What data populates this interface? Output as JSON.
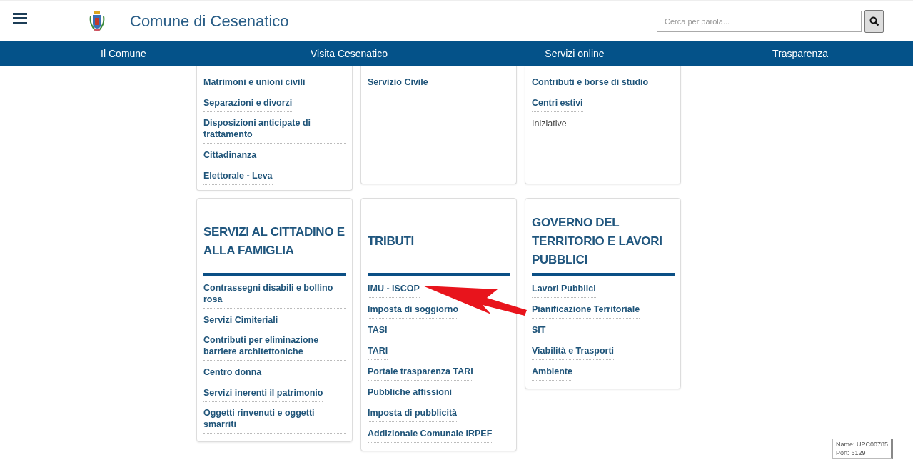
{
  "header": {
    "title": "Comune di Cesenatico",
    "search": {
      "placeholder": "Cerca per parola..."
    }
  },
  "nav": [
    {
      "label": "Il Comune"
    },
    {
      "label": "Visita Cesenatico"
    },
    {
      "label": "Servizi online"
    },
    {
      "label": "Trasparenza"
    }
  ],
  "card_rows": [
    [
      {
        "items": [
          {
            "label": "Matrimoni e unioni civili",
            "kind": "link"
          },
          {
            "label": "Separazioni e divorzi",
            "kind": "link"
          },
          {
            "label": "Disposizioni anticipate di trattamento",
            "kind": "link"
          },
          {
            "label": "Cittadinanza",
            "kind": "link"
          },
          {
            "label": "Elettorale - Leva",
            "kind": "link"
          }
        ]
      },
      {
        "items": [
          {
            "label": "Servizio Civile",
            "kind": "link"
          }
        ]
      },
      {
        "items": [
          {
            "label": "Contributi e borse di studio",
            "kind": "link"
          },
          {
            "label": "Centri estivi",
            "kind": "link"
          },
          {
            "label": "Iniziative",
            "kind": "plain"
          }
        ]
      }
    ],
    [
      {
        "heading": "SERVIZI AL CITTADINO E ALLA FAMIGLIA",
        "items": [
          {
            "label": "Contrassegni disabili e bollino rosa",
            "kind": "link"
          },
          {
            "label": "Servizi Cimiteriali",
            "kind": "link"
          },
          {
            "label": "Contributi per eliminazione barriere architettoniche",
            "kind": "link"
          },
          {
            "label": "Centro donna",
            "kind": "link"
          },
          {
            "label": "Servizi inerenti il patrimonio",
            "kind": "link"
          },
          {
            "label": "Oggetti rinvenuti e oggetti smarriti",
            "kind": "link"
          }
        ]
      },
      {
        "heading": "TRIBUTI",
        "items": [
          {
            "label": "IMU - ISCOP",
            "kind": "link"
          },
          {
            "label": "Imposta di soggiorno",
            "kind": "link"
          },
          {
            "label": "TASI",
            "kind": "link"
          },
          {
            "label": "TARI",
            "kind": "link"
          },
          {
            "label": "Portale trasparenza TARI",
            "kind": "link"
          },
          {
            "label": "Pubbliche affissioni",
            "kind": "link"
          },
          {
            "label": "Imposta di pubblicità",
            "kind": "link"
          },
          {
            "label": "Addizionale Comunale IRPEF",
            "kind": "link"
          }
        ]
      },
      {
        "heading": "GOVERNO DEL TERRITORIO E LAVORI PUBBLICI",
        "items": [
          {
            "label": "Lavori Pubblici",
            "kind": "link"
          },
          {
            "label": "Pianificazione Territoriale",
            "kind": "link"
          },
          {
            "label": "SIT",
            "kind": "link"
          },
          {
            "label": "Viabilità e Trasporti",
            "kind": "link"
          },
          {
            "label": "Ambiente",
            "kind": "link"
          }
        ]
      }
    ]
  ],
  "tooltip": {
    "lines": [
      "Name: UPC00785",
      "Port: 6129"
    ]
  }
}
